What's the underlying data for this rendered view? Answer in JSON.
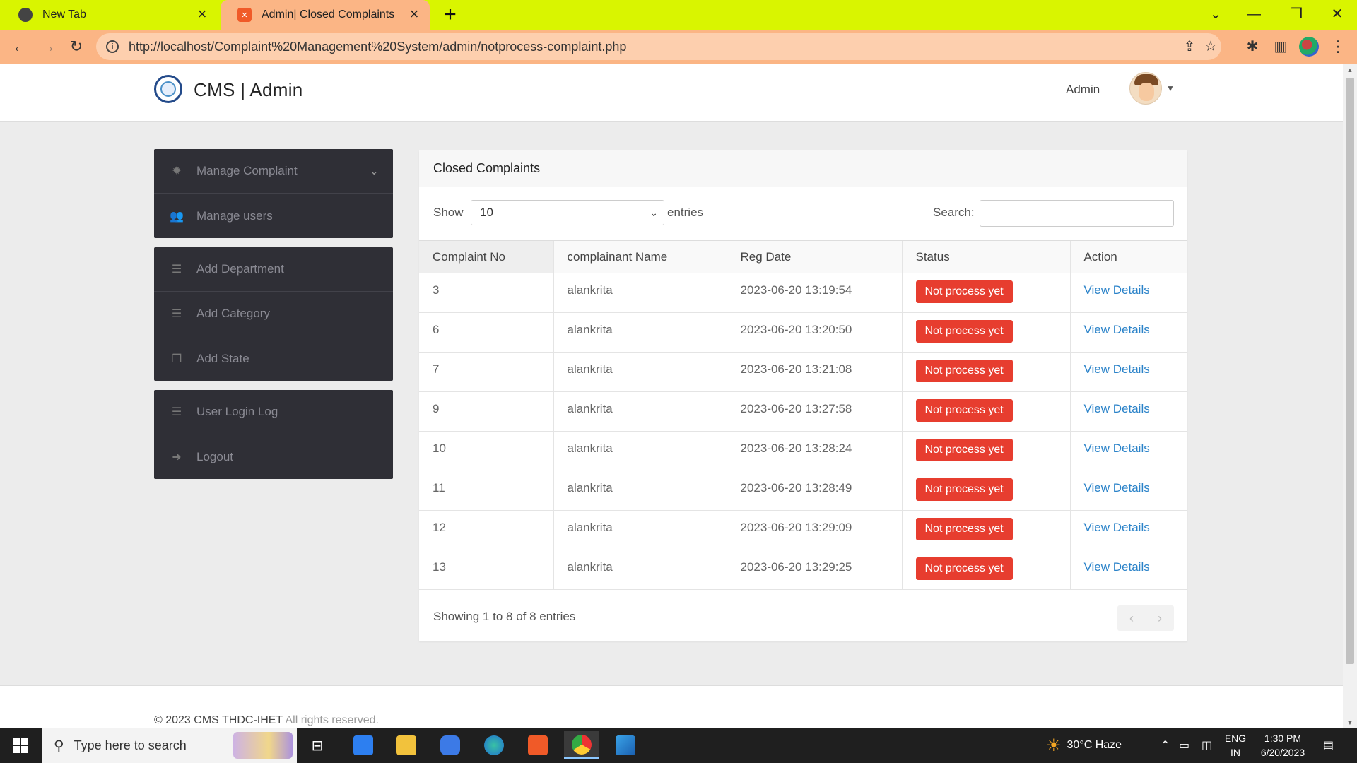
{
  "browser": {
    "tabs": [
      {
        "title": "New Tab"
      },
      {
        "title": "Admin| Closed Complaints"
      }
    ],
    "url": "http://localhost/Complaint%20Management%20System/admin/notprocess-complaint.php"
  },
  "header": {
    "brand": "CMS | Admin",
    "user_name": "Admin"
  },
  "sidebar": {
    "groups": [
      [
        {
          "label": "Manage Complaint",
          "icon": "gear-icon"
        },
        {
          "label": "Manage users",
          "icon": "users-icon"
        }
      ],
      [
        {
          "label": "Add Department",
          "icon": "list-icon"
        },
        {
          "label": "Add Category",
          "icon": "list-icon"
        },
        {
          "label": "Add State",
          "icon": "copy-icon"
        }
      ],
      [
        {
          "label": "User Login Log",
          "icon": "list-icon"
        },
        {
          "label": "Logout",
          "icon": "sign-out-icon"
        }
      ]
    ]
  },
  "panel": {
    "title": "Closed Complaints",
    "show_label": "Show",
    "page_size": "10",
    "entries_label": "entries",
    "search_label": "Search:",
    "search_value": "",
    "columns": [
      "Complaint No",
      "complainant Name",
      "Reg Date",
      "Status",
      "Action"
    ],
    "rows": [
      {
        "no": "3",
        "name": "alankrita",
        "date": "2023-06-20 13:19:54",
        "status": "Not process yet",
        "action": "View Details"
      },
      {
        "no": "6",
        "name": "alankrita",
        "date": "2023-06-20 13:20:50",
        "status": "Not process yet",
        "action": "View Details"
      },
      {
        "no": "7",
        "name": "alankrita",
        "date": "2023-06-20 13:21:08",
        "status": "Not process yet",
        "action": "View Details"
      },
      {
        "no": "9",
        "name": "alankrita",
        "date": "2023-06-20 13:27:58",
        "status": "Not process yet",
        "action": "View Details"
      },
      {
        "no": "10",
        "name": "alankrita",
        "date": "2023-06-20 13:28:24",
        "status": "Not process yet",
        "action": "View Details"
      },
      {
        "no": "11",
        "name": "alankrita",
        "date": "2023-06-20 13:28:49",
        "status": "Not process yet",
        "action": "View Details"
      },
      {
        "no": "12",
        "name": "alankrita",
        "date": "2023-06-20 13:29:09",
        "status": "Not process yet",
        "action": "View Details"
      },
      {
        "no": "13",
        "name": "alankrita",
        "date": "2023-06-20 13:29:25",
        "status": "Not process yet",
        "action": "View Details"
      }
    ],
    "info": "Showing 1 to 8 of 8 entries"
  },
  "footer": {
    "copyright": "© 2023 CMS THDC-IHET",
    "rights": " All rights reserved."
  },
  "taskbar": {
    "search_placeholder": "Type here to search",
    "weather": "30°C  Haze",
    "lang_top": "ENG",
    "lang_bottom": "IN",
    "time": "1:30 PM",
    "date": "6/20/2023"
  },
  "colors": {
    "tabbar": "#d9f500",
    "toolbar": "#fbb585",
    "sidebar": "#2f2f36",
    "badge": "#e73d2f",
    "link": "#2b83c9"
  }
}
